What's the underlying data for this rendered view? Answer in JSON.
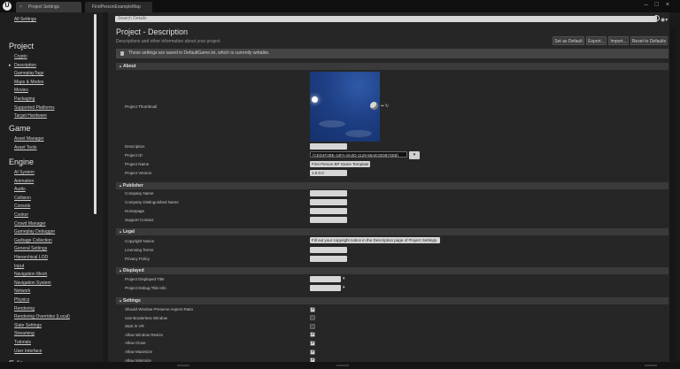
{
  "tabs": [
    {
      "label": "Project Settings",
      "active": true
    },
    {
      "label": "FirstPersonExampleMap",
      "active": false
    }
  ],
  "nav": {
    "all_settings": "All Settings",
    "groups": [
      {
        "title": "Project",
        "items": [
          "Crypto",
          "Description",
          "GameplayTags",
          "Maps & Modes",
          "Movies",
          "Packaging",
          "Supported Platforms",
          "Target Hardware"
        ],
        "selected": "Description"
      },
      {
        "title": "Game",
        "items": [
          "Asset Manager",
          "Asset Tools"
        ]
      },
      {
        "title": "Engine",
        "items": [
          "AI System",
          "Animation",
          "Audio",
          "Collision",
          "Console",
          "Cooker",
          "Crowd Manager",
          "Gameplay Debugger",
          "Garbage Collection",
          "General Settings",
          "Hierarchical LOD",
          "Input",
          "Navigation Mesh",
          "Navigation System",
          "Network",
          "Physics",
          "Rendering",
          "Rendering Overrides (Local)",
          "Slate Settings",
          "Streaming",
          "Tutorials",
          "User Interface"
        ]
      },
      {
        "title": "Editor",
        "items": []
      }
    ]
  },
  "search": {
    "placeholder": "Search Details"
  },
  "page": {
    "title": "Project - Description",
    "subtitle": "Descriptions and other information about your project.",
    "buttons": {
      "set_default": "Set as Default",
      "export": "Export...",
      "import": "Import...",
      "reset": "Reset to Defaults"
    },
    "notice": "These settings are saved in DefaultGame.ini, which is currently writable."
  },
  "about": {
    "header": "About",
    "thumbnail_label": "Project Thumbnail",
    "description_label": "Description",
    "description_value": "",
    "project_id_label": "Project ID",
    "project_id_value": "{CED4F2BE-44FA-8A2D-1129-56AE32DB72EB}",
    "project_name_label": "Project Name",
    "project_name_value": "First Person BP Game Template",
    "project_version_label": "Project Version",
    "project_version_value": "1.0.0.0"
  },
  "publisher": {
    "header": "Publisher",
    "company_name": "Company Name",
    "company_distinguished_name": "Company Distinguished Name",
    "homepage": "Homepage",
    "support_contact": "Support Contact"
  },
  "legal": {
    "header": "Legal",
    "copyright_label": "Copyright Notice",
    "copyright_value": "Fill out your copyright notice in the Description page of Project Settings.",
    "licensing_terms": "Licensing Terms",
    "privacy_policy": "Privacy Policy"
  },
  "displayed": {
    "header": "Displayed",
    "project_displayed_title": "Project Displayed Title",
    "project_debug_title_info": "Project Debug Title Info"
  },
  "settings": {
    "header": "Settings",
    "rows": [
      {
        "label": "Should Window Preserve Aspect Ratio",
        "checked": true
      },
      {
        "label": "Use Borderless Window",
        "checked": false
      },
      {
        "label": "Start in VR",
        "checked": false
      },
      {
        "label": "Allow Window Resize",
        "checked": true
      },
      {
        "label": "Allow Close",
        "checked": true
      },
      {
        "label": "Allow Maximize",
        "checked": true
      },
      {
        "label": "Allow Minimize",
        "checked": true
      }
    ]
  }
}
